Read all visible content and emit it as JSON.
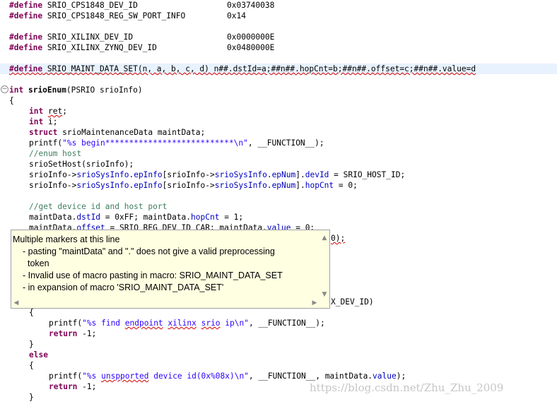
{
  "code": {
    "l1": {
      "pp": "#define",
      "rest": " SRIO_CPS1848_DEV_ID",
      "val": "0x03740038"
    },
    "l2": {
      "pp": "#define",
      "rest": " SRIO_CPS1848_REG_SW_PORT_INFO",
      "val": "0x14"
    },
    "l3": {
      "pp": "#define",
      "rest": " SRIO_XILINX_DEV_ID",
      "val": "0x0000000E"
    },
    "l4": {
      "pp": "#define",
      "rest": " SRIO_XILINX_ZYNQ_DEV_ID",
      "val": "0x0480000E"
    },
    "l5": {
      "pp": "#define",
      "rest": " SRIO_MAINT_DATA_SET(n, a, b, c, d) n##.dstId=a;##n##.hopCnt=b;##n##.offset=c;##n##.value=d"
    },
    "l6": {
      "kw": "int",
      "fn": "srioEnum",
      "rest": "(PSRIO srioInfo)"
    },
    "l7": "{",
    "l8": {
      "kw": "int",
      "err": "ret",
      "rest": ";"
    },
    "l9": {
      "kw": "int",
      "rest": " i;"
    },
    "l10": {
      "kw": "struct",
      "rest": " srioMaintenanceData maintData;"
    },
    "l11": {
      "a": "printf(",
      "str": "\"%s begin***************************\\n\"",
      "b": ", __FUNCTION__);"
    },
    "l12": "//enum host",
    "l13": "srioSetHost(srioInfo);",
    "l14": {
      "a": "srioInfo->",
      "f1": "srioSysInfo",
      "b": ".",
      "f2": "epInfo",
      "c": "[srioInfo->",
      "f3": "srioSysInfo",
      "d": ".",
      "f4": "epNum",
      "e": "].",
      "f5": "devId",
      "g": " = SRIO_HOST_ID;"
    },
    "l15": {
      "a": "srioInfo->",
      "f1": "srioSysInfo",
      "b": ".",
      "f2": "epInfo",
      "c": "[srioInfo->",
      "f3": "srioSysInfo",
      "d": ".",
      "f4": "epNum",
      "e": "].",
      "f5": "hopCnt",
      "g": " = 0;"
    },
    "l16": "//get device id and host port",
    "l17": {
      "a": "maintData.",
      "f1": "dstId",
      "b": " = 0xFF; maintData.",
      "f2": "hopCnt",
      "c": " = 1;"
    },
    "l18": {
      "a": "maintData.",
      "f1": "offset",
      "b": " = SRIO_REG_DEV_ID_CAR; maintData.",
      "f2": "value",
      "c": " = 0;"
    },
    "l19": "0);",
    "l20": "X_DEV_ID)",
    "l21": "{",
    "l22": {
      "a": "printf(",
      "str": "\"%s find ",
      "e1": "endpoint",
      "s2": " ",
      "e2": "xilinx",
      "s3": " ",
      "e3": "srio",
      "s4": " ip\\n\"",
      "b": ", __FUNCTION__);"
    },
    "l23": {
      "kw": "return",
      "rest": " -1;"
    },
    "l24": "}",
    "l25": "else",
    "l26": "{",
    "l27": {
      "a": "printf(",
      "str": "\"%s ",
      "e1": "unspported",
      "s2": " device id(0x%08x)\\n\"",
      "b": ", __FUNCTION__, maintData.",
      "f1": "value",
      "c": ");"
    },
    "l28": {
      "kw": "return",
      "rest": " -1;"
    },
    "l29": "}"
  },
  "tooltip": {
    "title": "Multiple markers at this line",
    "item1a": "- pasting \"maintData\" and \".\" does not give a valid preprocessing",
    "item1b": "token",
    "item2": "- Invalid use of macro pasting in macro: SRIO_MAINT_DATA_SET",
    "item3": "- in expansion of macro 'SRIO_MAINT_DATA_SET'"
  },
  "watermark": "https://blog.csdn.net/Zhu_Zhu_2009",
  "icons": {
    "fold": "fold-collapse-icon",
    "scroll_up": "scroll-up-arrow-icon",
    "scroll_down": "scroll-down-arrow-icon",
    "scroll_left": "scroll-left-arrow-icon",
    "scroll_right": "scroll-right-arrow-icon"
  },
  "colors": {
    "keyword": "#7f0055",
    "string": "#2a00ff",
    "comment": "#3f7f5f",
    "field": "#0000c0",
    "tooltip_bg": "#ffffe1",
    "error_underline": "#d40000"
  }
}
